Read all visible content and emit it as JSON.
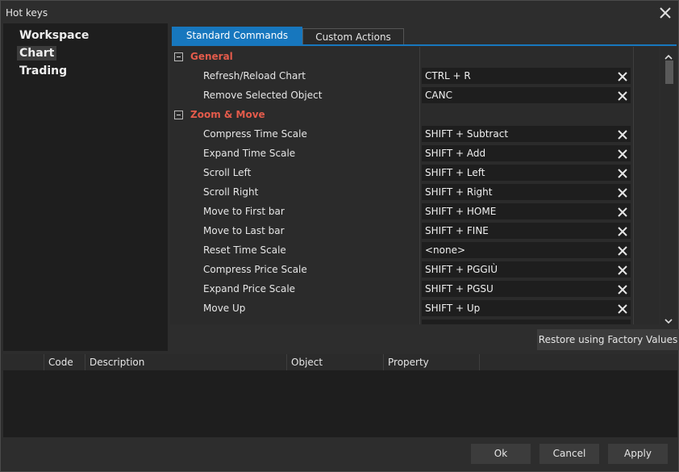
{
  "window": {
    "title": "Hot keys"
  },
  "sidebar": {
    "items": [
      {
        "label": "Workspace"
      },
      {
        "label": "Chart"
      },
      {
        "label": "Trading"
      }
    ]
  },
  "tabs": [
    {
      "label": "Standard Commands"
    },
    {
      "label": "Custom Actions"
    }
  ],
  "groups": [
    {
      "title": "General",
      "rows": [
        {
          "label": "Refresh/Reload Chart",
          "value": "CTRL + R"
        },
        {
          "label": "Remove Selected Object",
          "value": "CANC"
        }
      ]
    },
    {
      "title": "Zoom & Move",
      "rows": [
        {
          "label": "Compress Time Scale",
          "value": "SHIFT + Subtract"
        },
        {
          "label": "Expand Time Scale",
          "value": "SHIFT + Add"
        },
        {
          "label": "Scroll Left",
          "value": "SHIFT + Left"
        },
        {
          "label": "Scroll Right",
          "value": "SHIFT + Right"
        },
        {
          "label": "Move to First bar",
          "value": "SHIFT + HOME"
        },
        {
          "label": "Move to Last bar",
          "value": "SHIFT + FINE"
        },
        {
          "label": "Reset Time Scale",
          "value": "<none>"
        },
        {
          "label": "Compress Price Scale",
          "value": "SHIFT + PGGIÙ"
        },
        {
          "label": "Expand Price Scale",
          "value": "SHIFT + PGSU"
        },
        {
          "label": "Move Up",
          "value": "SHIFT + Up"
        }
      ]
    }
  ],
  "restore_button": "Restore using Factory Values",
  "error_table": {
    "columns": [
      "",
      "Code",
      "Description",
      "Object",
      "Property"
    ]
  },
  "buttons": {
    "ok": "Ok",
    "cancel": "Cancel",
    "apply": "Apply"
  },
  "colors": {
    "accent": "#1777be",
    "group_header": "#e45b4b"
  }
}
